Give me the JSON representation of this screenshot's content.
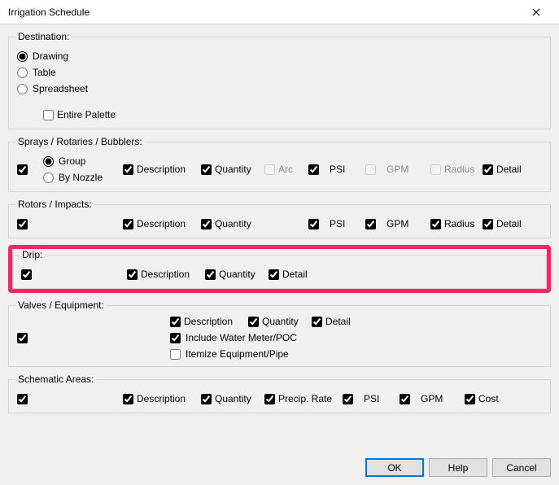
{
  "window": {
    "title": "Irrigation Schedule"
  },
  "destination": {
    "legend": "Destination:",
    "drawing": "Drawing",
    "table": "Table",
    "spreadsheet": "Spreadsheet",
    "entire_palette": "Entire Palette"
  },
  "sprays": {
    "legend": "Sprays / Rotaries / Bubblers:",
    "group": "Group",
    "by_nozzle": "By Nozzle",
    "description": "Description",
    "quantity": "Quantity",
    "arc": "Arc",
    "psi": "PSI",
    "gpm": "GPM",
    "radius": "Radius",
    "detail": "Detail"
  },
  "rotors": {
    "legend": "Rotors / Impacts:",
    "description": "Description",
    "quantity": "Quantity",
    "psi": "PSI",
    "gpm": "GPM",
    "radius": "Radius",
    "detail": "Detail"
  },
  "drip": {
    "legend": "Drip:",
    "description": "Description",
    "quantity": "Quantity",
    "detail": "Detail"
  },
  "valves": {
    "legend": "Valves / Equipment:",
    "description": "Description",
    "quantity": "Quantity",
    "detail": "Detail",
    "include_meter": "Include Water Meter/POC",
    "itemize": "Itemize Equipment/Pipe"
  },
  "schematic": {
    "legend": "Schematic Areas:",
    "description": "Description",
    "quantity": "Quantity",
    "precip": "Precip. Rate",
    "psi": "PSI",
    "gpm": "GPM",
    "cost": "Cost"
  },
  "buttons": {
    "ok": "OK",
    "help": "Help",
    "cancel": "Cancel"
  }
}
